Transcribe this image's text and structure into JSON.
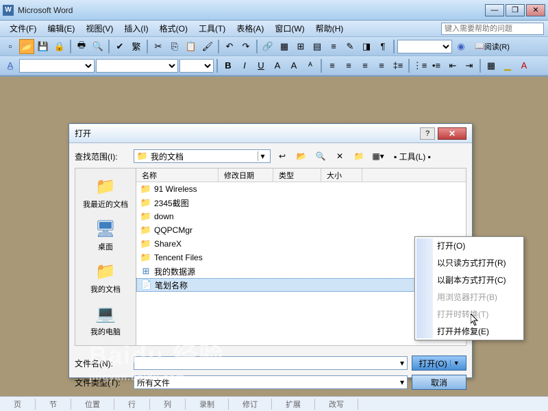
{
  "app": {
    "title": "Microsoft Word"
  },
  "winbtns": {
    "min": "—",
    "max": "❐",
    "close": "✕"
  },
  "menu": {
    "items": [
      "文件(F)",
      "编辑(E)",
      "视图(V)",
      "插入(I)",
      "格式(O)",
      "工具(T)",
      "表格(A)",
      "窗口(W)",
      "帮助(H)"
    ],
    "help_placeholder": "键入需要帮助的问题"
  },
  "toolbar2": {
    "read_label": "阅读(R)"
  },
  "status": {
    "cells": [
      "页",
      "节",
      "位置",
      "行",
      "列",
      "录制",
      "修订",
      "扩展",
      "改写"
    ]
  },
  "dialog": {
    "title": "打开",
    "lookin_label": "查找范围(I):",
    "lookin_value": "我的文档",
    "tools_label": "▪ 工具(L) ▪",
    "cols": {
      "name": "名称",
      "date": "修改日期",
      "type": "类型",
      "size": "大小"
    },
    "places": [
      {
        "label": "我最近的文档",
        "icon": "folder"
      },
      {
        "label": "桌面",
        "icon": "desktop"
      },
      {
        "label": "我的文档",
        "icon": "folder"
      },
      {
        "label": "我的电脑",
        "icon": "computer"
      }
    ],
    "files": [
      {
        "name": "91 Wireless",
        "kind": "fold"
      },
      {
        "name": "2345截图",
        "kind": "fold"
      },
      {
        "name": "down",
        "kind": "fold"
      },
      {
        "name": "QQPCMgr",
        "kind": "fold"
      },
      {
        "name": "ShareX",
        "kind": "fold"
      },
      {
        "name": "Tencent Files",
        "kind": "fold"
      },
      {
        "name": "我的数据源",
        "kind": "data"
      },
      {
        "name": "笔划名称",
        "kind": "doc",
        "selected": true
      }
    ],
    "filename_label": "文件名(N):",
    "filename_value": "",
    "filetype_label": "文件类型(T):",
    "filetype_value": "所有文件",
    "open_btn": "打开(O)",
    "cancel_btn": "取消"
  },
  "ctx": {
    "items": [
      {
        "label": "打开(O)",
        "disabled": false
      },
      {
        "label": "以只读方式打开(R)",
        "disabled": false
      },
      {
        "label": "以副本方式打开(C)",
        "disabled": false
      },
      {
        "label": "用浏览器打开(B)",
        "disabled": true
      },
      {
        "label": "打开时转换(T)",
        "disabled": true
      },
      {
        "label": "打开并修复(E)",
        "disabled": false
      }
    ]
  },
  "watermark": {
    "main": "Baidu 经验",
    "sub": "jingyan.baidu.com"
  }
}
